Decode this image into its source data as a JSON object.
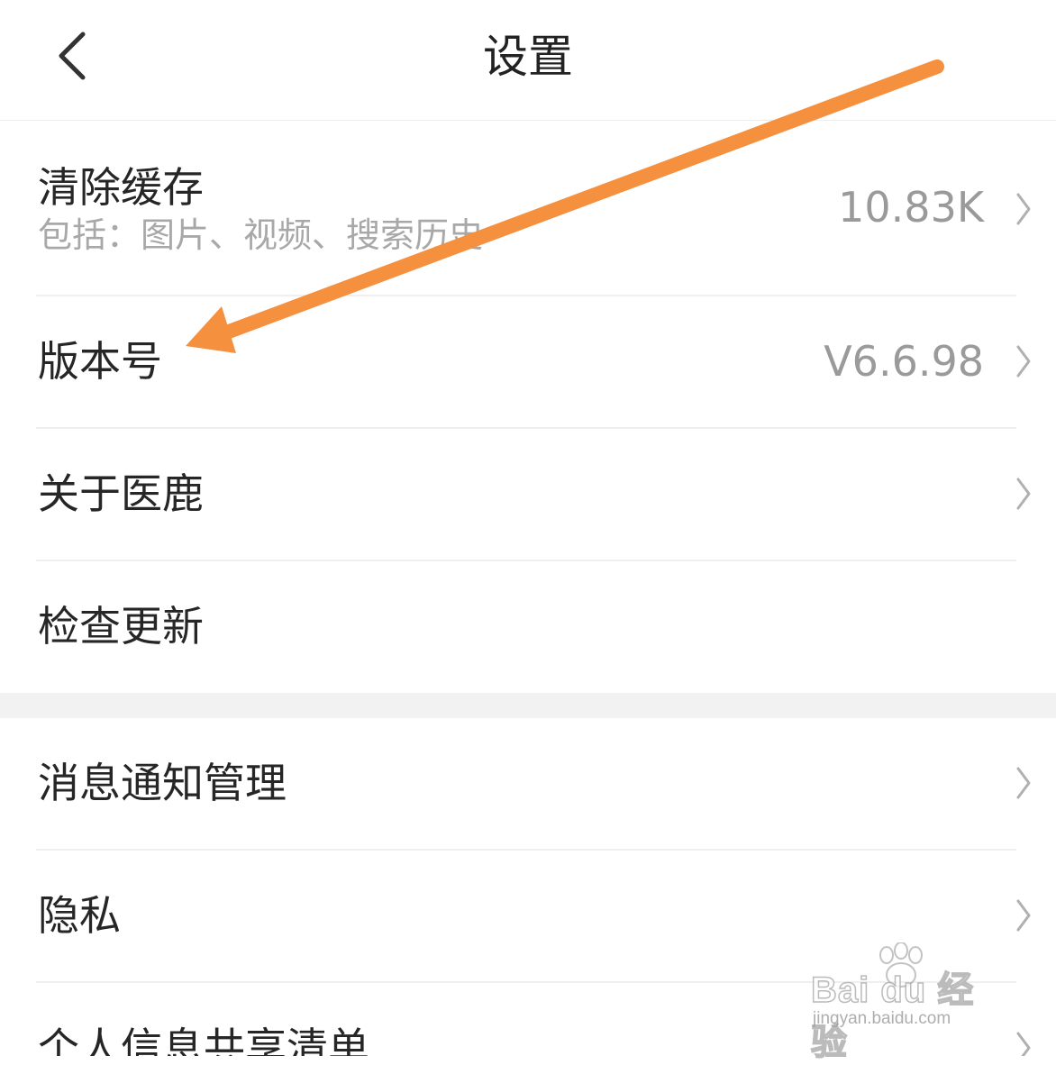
{
  "header": {
    "title": "设置",
    "back_icon": "chevron-left-icon"
  },
  "rows": [
    {
      "label": "清除缓存",
      "sub": "包括：图片、视频、搜索历史",
      "value": "10.83K"
    },
    {
      "label": "版本号",
      "value": "V6.6.98"
    },
    {
      "label": "关于医鹿"
    },
    {
      "label": "检查更新"
    },
    {
      "label": "消息通知管理"
    },
    {
      "label": "隐私"
    },
    {
      "label": "个人信息共享清单"
    }
  ],
  "annotation": {
    "arrow_color": "#f5903e"
  },
  "watermark": {
    "brand": "Bai du 经验",
    "url": "jingyan.baidu.com"
  },
  "colors": {
    "divider": "#efefef",
    "section_gap": "#f2f2f2",
    "secondary_text": "#a8a8a8"
  }
}
